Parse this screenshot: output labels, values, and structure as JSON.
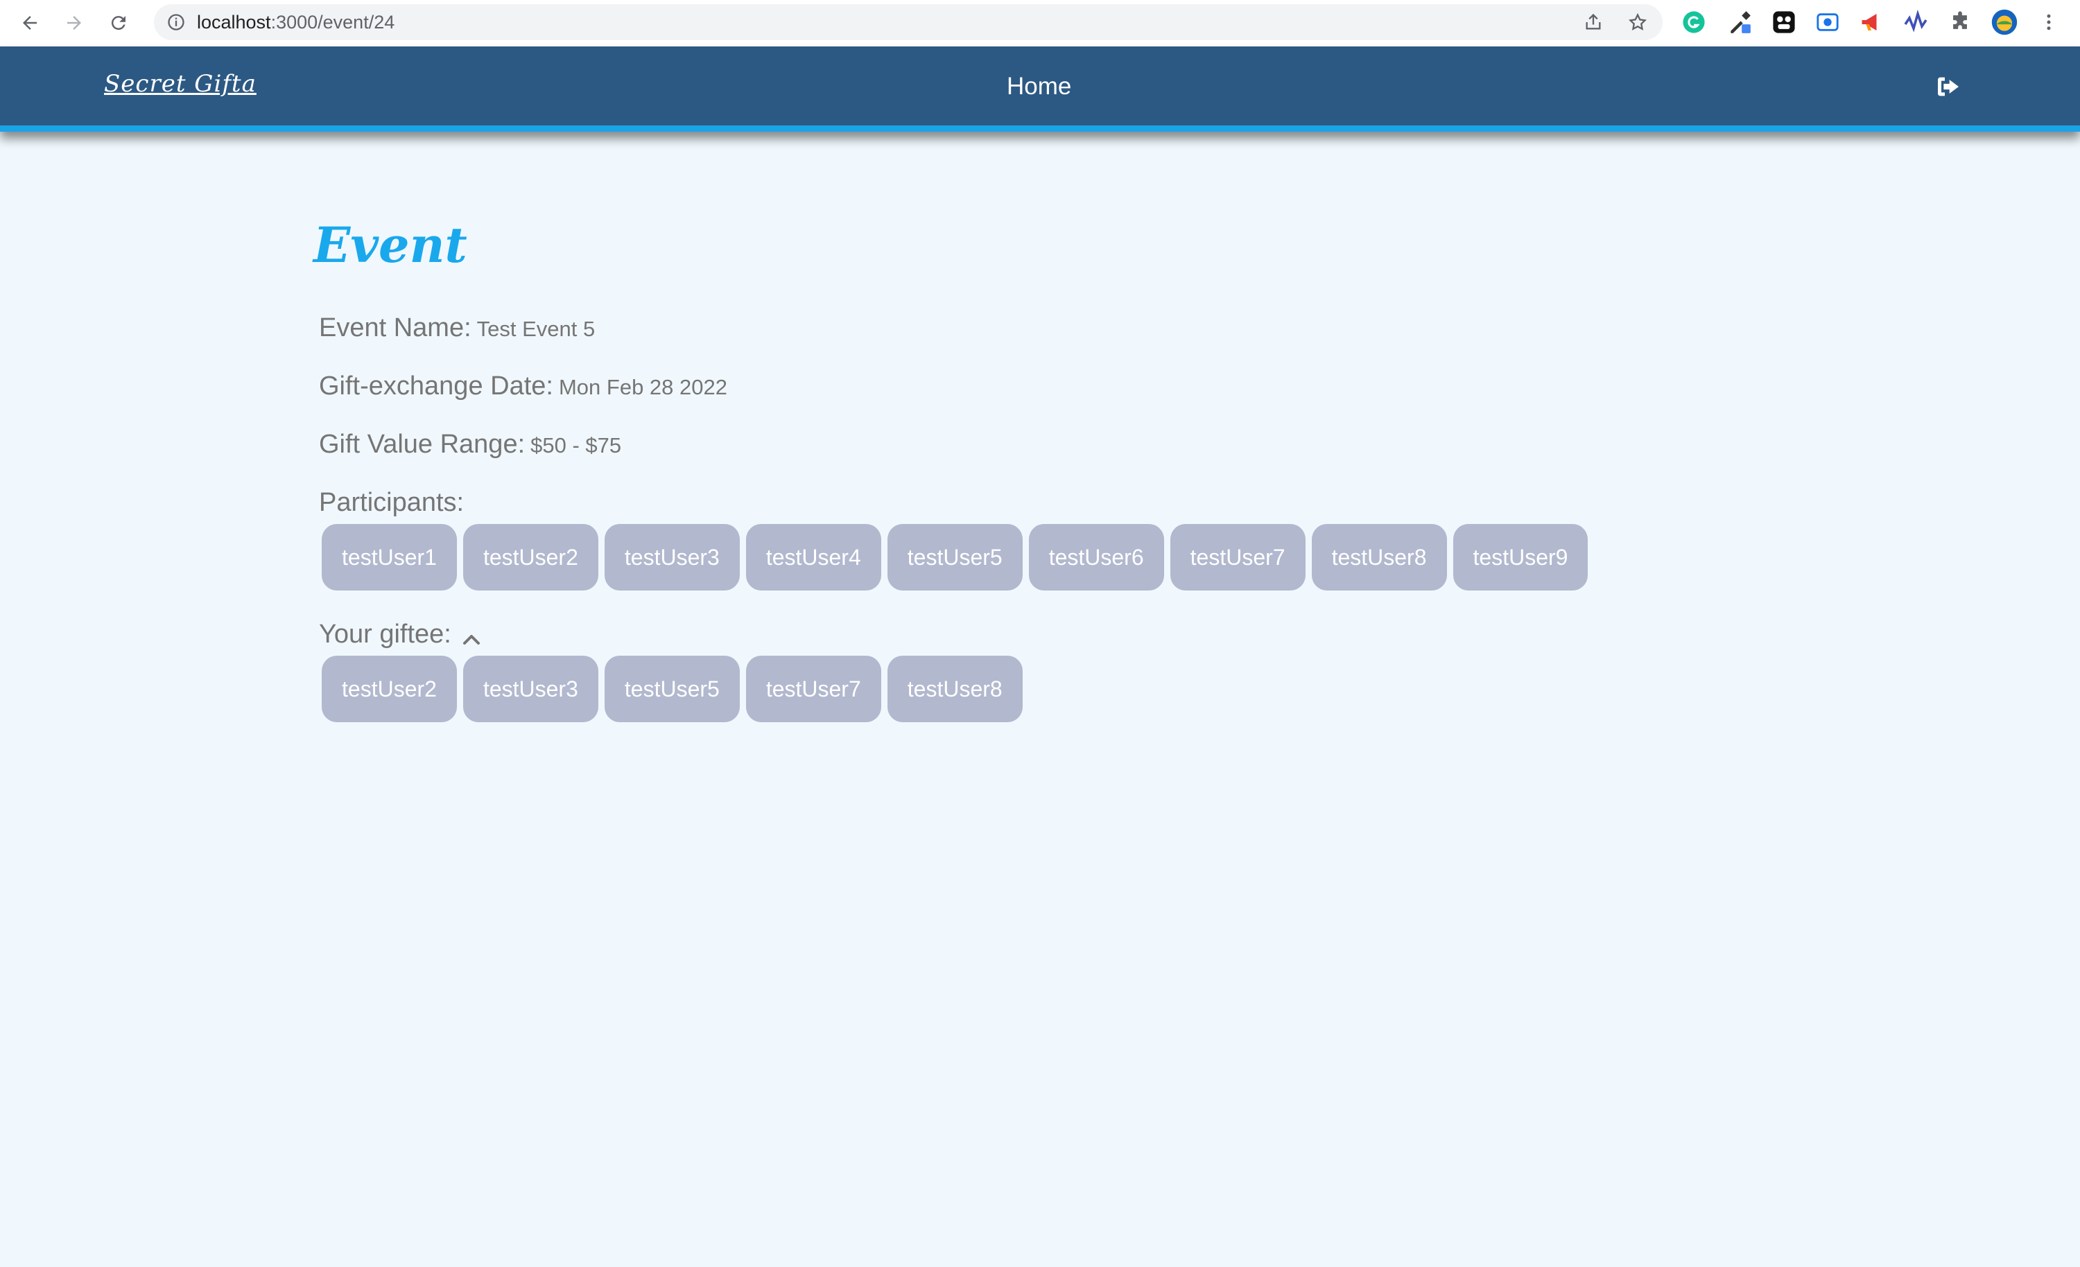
{
  "browser": {
    "url_host": "localhost",
    "url_path": ":3000/event/24"
  },
  "header": {
    "brand": "Secret Gifta",
    "home_label": "Home"
  },
  "page": {
    "title": "Event",
    "event_name_label": "Event Name:",
    "event_name_value": "Test Event 5",
    "date_label": "Gift-exchange Date:",
    "date_value": "Mon Feb 28 2022",
    "range_label": "Gift Value Range:",
    "range_value": "$50 - $75",
    "participants_label": "Participants:",
    "participants": [
      "testUser1",
      "testUser2",
      "testUser3",
      "testUser4",
      "testUser5",
      "testUser6",
      "testUser7",
      "testUser8",
      "testUser9"
    ],
    "giftee_label": "Your giftee:",
    "giftees": [
      "testUser2",
      "testUser3",
      "testUser5",
      "testUser7",
      "testUser8"
    ]
  },
  "colors": {
    "header_bg": "#2c5983",
    "header_accent": "#19a3e8",
    "title": "#1aa8ec",
    "chip_bg": "#b2b8ce",
    "page_bg": "#f0f8fd"
  }
}
